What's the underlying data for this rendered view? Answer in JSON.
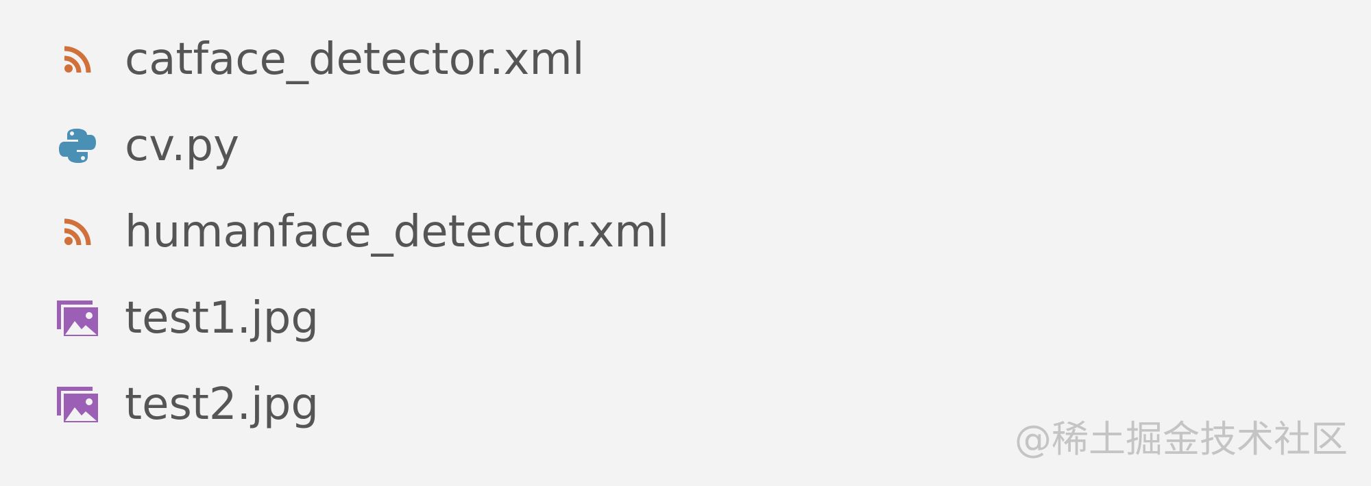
{
  "colors": {
    "background": "#f3f3f3",
    "text": "#555555",
    "xml_icon": "#d0703a",
    "python_icon": "#4a8fb4",
    "image_icon": "#9b5fb5",
    "watermark": "#c4c4c4"
  },
  "files": [
    {
      "name": "catface_detector.xml",
      "icon": "rss-icon"
    },
    {
      "name": "cv.py",
      "icon": "python-icon"
    },
    {
      "name": "humanface_detector.xml",
      "icon": "rss-icon"
    },
    {
      "name": "test1.jpg",
      "icon": "image-icon"
    },
    {
      "name": "test2.jpg",
      "icon": "image-icon"
    }
  ],
  "watermark": "@稀土掘金技术社区"
}
